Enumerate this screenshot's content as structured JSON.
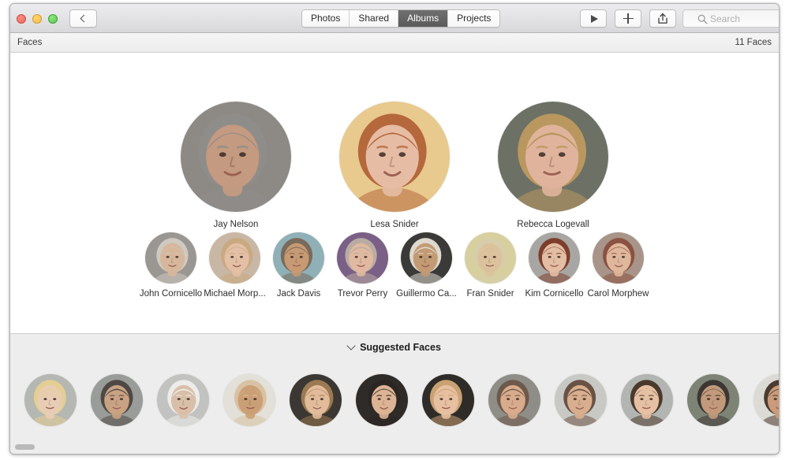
{
  "window": {
    "traffic_lights": [
      "close",
      "minimize",
      "zoom"
    ],
    "back_label": "back"
  },
  "toolbar": {
    "segments": [
      {
        "label": "Photos",
        "active": false
      },
      {
        "label": "Shared",
        "active": false
      },
      {
        "label": "Albums",
        "active": true
      },
      {
        "label": "Projects",
        "active": false
      }
    ],
    "play_label": "Play Slideshow",
    "add_label": "Add",
    "share_label": "Share",
    "search_placeholder": "Search",
    "search_value": ""
  },
  "sub_header": {
    "title": "Faces",
    "count": "11 Faces"
  },
  "faces": {
    "featured": [
      {
        "name": "Jay Nelson",
        "bg": "#8d8a85",
        "skin": "#c49a80",
        "hair": "#8f8d8a"
      },
      {
        "name": "Lesa Snider",
        "bg": "#e8c98e",
        "skin": "#e6bda4",
        "hair": "#b5683c"
      },
      {
        "name": "Rebecca Logevall",
        "bg": "#6d7165",
        "skin": "#e0b49c",
        "hair": "#b9975f"
      }
    ],
    "others": [
      {
        "name": "John Cornicello",
        "bg": "#9a9691",
        "skin": "#d7b79c",
        "hair": "#cfc9c1"
      },
      {
        "name": "Michael Morp...",
        "bg": "#c9b7a5",
        "skin": "#e3bfa5",
        "hair": "#c9a980"
      },
      {
        "name": "Jack Davis",
        "bg": "#8fb0b6",
        "skin": "#c79a74",
        "hair": "#7a6a5c"
      },
      {
        "name": "Trevor Perry",
        "bg": "#7a5f86",
        "skin": "#e0b9a0",
        "hair": "#b8aca2"
      },
      {
        "name": "Guillermo Ca...",
        "bg": "#3a3a38",
        "skin": "#c29a74",
        "hair": "#ded9cf"
      },
      {
        "name": "Fran Snider",
        "bg": "#d8cf9f",
        "skin": "#dcc29c",
        "hair": "#d6cdaa"
      },
      {
        "name": "Kim Cornicello",
        "bg": "#a8a6a3",
        "skin": "#e3bda4",
        "hair": "#7d3f2c"
      },
      {
        "name": "Carol Morphew",
        "bg": "#a89488",
        "skin": "#e0b79c",
        "hair": "#8a5242"
      }
    ]
  },
  "suggested": {
    "title": "Suggested Faces",
    "expanded": true,
    "thumbnails": [
      {
        "bg": "#b5b7b3",
        "skin": "#e8cdb4",
        "hair": "#e3cf92"
      },
      {
        "bg": "#9a9c99",
        "skin": "#c9a183",
        "hair": "#4e4944"
      },
      {
        "bg": "#c2c3c0",
        "skin": "#d9bfa8",
        "hair": "#ececea"
      },
      {
        "bg": "#e2e0d9",
        "skin": "#cb9f76",
        "hair": "#d8c2a3"
      },
      {
        "bg": "#3b3733",
        "skin": "#e2bb9a",
        "hair": "#9a7a52"
      },
      {
        "bg": "#2f2b29",
        "skin": "#dcb394",
        "hair": "#2b2623"
      },
      {
        "bg": "#2e2b28",
        "skin": "#e6c0a1",
        "hair": "#c9a173"
      },
      {
        "bg": "#8e8d88",
        "skin": "#d8ab8c",
        "hair": "#6d584a"
      },
      {
        "bg": "#c8c9c5",
        "skin": "#d8ae8e",
        "hair": "#6a5246"
      },
      {
        "bg": "#b3b5b2",
        "skin": "#e5c0a3",
        "hair": "#4a3a2e"
      },
      {
        "bg": "#7d8476",
        "skin": "#c29a7b",
        "hair": "#3c3733"
      },
      {
        "bg": "#dcdad5",
        "skin": "#c99b7a",
        "hair": "#4b3b30"
      },
      {
        "bg": "#e8e6e1",
        "skin": "#cda183",
        "hair": "#7a4f35"
      }
    ],
    "scrollbar_position": "left"
  }
}
